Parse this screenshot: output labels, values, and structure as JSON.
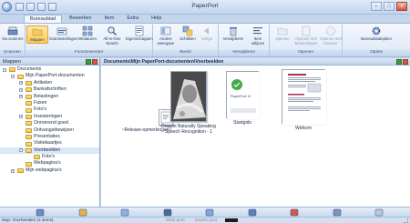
{
  "window": {
    "title": "PaperPort"
  },
  "window_controls": {
    "minimize": "–",
    "maximize": "□",
    "close": "x"
  },
  "tabs": [
    {
      "label": "Bureaublad",
      "active": true
    },
    {
      "label": "Bewerken"
    },
    {
      "label": "Item"
    },
    {
      "label": "Extra"
    },
    {
      "label": "Help"
    }
  ],
  "ribbon": {
    "groups": [
      {
        "label": "Scannen"
      },
      {
        "label": "Functievenster"
      },
      {
        "label": "Beeld"
      },
      {
        "label": "Verwijderen"
      },
      {
        "label": "Openen"
      },
      {
        "label": "Opties"
      }
    ],
    "buttons": {
      "nu_scannen": "Nu scannen",
      "mappen": "Mappen",
      "scaninstellingen": "Scaninstellingen",
      "miniaturen": "Miniaturen",
      "all_in_one_search": "All-in-One Search",
      "eigenschappen": "Eigenschappen",
      "andere_weergave": "Andere weergave",
      "schikken": "Schikken",
      "vorige": "Vorige",
      "verwijderen": "Verwijderen",
      "item_uitlijnen": "Item uitlijnen",
      "openen": "Openen",
      "openen_met_bewerkingen": "Openen met Bewerkingen",
      "openen_met_browser": "Openen met browser",
      "bureaubladopties": "Bureaubladopties"
    }
  },
  "sidebar": {
    "title": "Mappen",
    "tree": [
      {
        "label": "Documents",
        "level": 0,
        "expander": "−"
      },
      {
        "label": "Mijn PaperPort-documenten",
        "level": 1,
        "expander": "−"
      },
      {
        "label": "Artikelen",
        "level": 2,
        "expander": "+"
      },
      {
        "label": "Bankafschriften",
        "level": 2,
        "expander": "+"
      },
      {
        "label": "Belastingen",
        "level": 2,
        "expander": "+"
      },
      {
        "label": "Faxen",
        "level": 2,
        "expander": ""
      },
      {
        "label": "Foto's",
        "level": 2,
        "expander": ""
      },
      {
        "label": "Investeringen",
        "level": 2,
        "expander": "+"
      },
      {
        "label": "Onroerend goed",
        "level": 2,
        "expander": ""
      },
      {
        "label": "Ontvangstbewijzen",
        "level": 2,
        "expander": ""
      },
      {
        "label": "Presentaties",
        "level": 2,
        "expander": ""
      },
      {
        "label": "Visitekaartjes",
        "level": 2,
        "expander": ""
      },
      {
        "label": "Voorbeelden",
        "level": 2,
        "expander": "−",
        "selected": true
      },
      {
        "label": "Foto's",
        "level": 3,
        "expander": ""
      },
      {
        "label": "Webpagina's",
        "level": 2,
        "expander": ""
      },
      {
        "label": "Mijn webpagina's",
        "level": 1,
        "expander": "+"
      }
    ]
  },
  "main": {
    "path": "Documents\\Mijn PaperPort-documenten\\Voorbeelden",
    "items": [
      {
        "caption": "~Release-opmerkingen~"
      },
      {
        "caption": "Dragon Naturally Speaking Speech Recognition - 1"
      },
      {
        "caption": "Startgids",
        "thumb_text": "PaperPort 12"
      },
      {
        "caption": "Welkom"
      }
    ]
  },
  "sendbar": {
    "icons": [
      "scanner-icon",
      "paint-icon",
      "scissors-icon",
      "viewer-icon",
      "calendar-icon",
      "ftp-icon",
      "pdf-icon",
      "search-icon",
      "print-icon"
    ]
  },
  "status": {
    "text": "Map: Voorbeelden (4 items).",
    "view_label": "Witte punt",
    "zoom_label": "Zwarte punt"
  },
  "colors": {
    "ribbon_selected": "#ffc95a",
    "folder": "#f0c348",
    "accent_blue": "#c5d6ec"
  }
}
